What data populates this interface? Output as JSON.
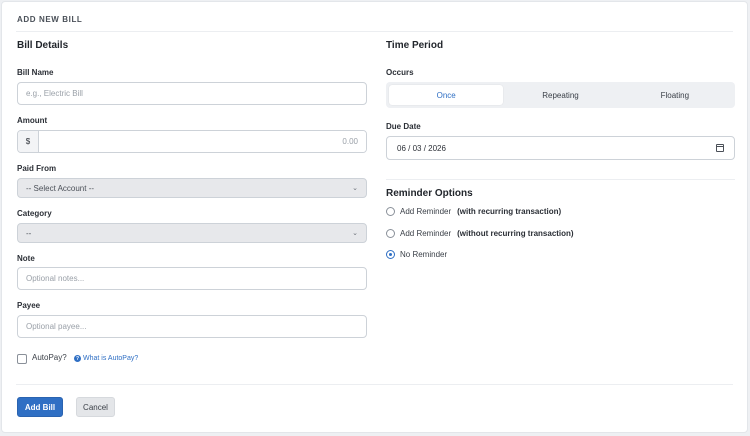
{
  "header": {
    "title": "ADD NEW BILL"
  },
  "bill_details": {
    "title": "Bill Details",
    "bill_name": {
      "label": "Bill Name",
      "placeholder": "e.g., Electric Bill",
      "value": ""
    },
    "amount": {
      "label": "Amount",
      "prefix": "$",
      "placeholder": "0.00",
      "value": ""
    },
    "paid_from": {
      "label": "Paid From",
      "selected": "-- Select Account --"
    },
    "category": {
      "label": "Category",
      "selected": "--"
    },
    "note": {
      "label": "Note",
      "placeholder": "Optional notes...",
      "value": ""
    },
    "payee": {
      "label": "Payee",
      "placeholder": "Optional payee...",
      "value": ""
    },
    "autopay": {
      "label": "AutoPay?",
      "checked": false,
      "help_label": "What is AutoPay?"
    }
  },
  "time_period": {
    "title": "Time Period",
    "occurs_label": "Occurs",
    "options": [
      {
        "label": "Once",
        "active": true
      },
      {
        "label": "Repeating",
        "active": false
      },
      {
        "label": "Floating",
        "active": false
      }
    ],
    "due_date": {
      "label": "Due Date",
      "value": "06 / 03 / 2026"
    }
  },
  "reminder": {
    "title": "Reminder Options",
    "options": [
      {
        "label": "Add Reminder",
        "suffix": "(with recurring transaction)",
        "checked": false
      },
      {
        "label": "Add Reminder",
        "suffix": "(without recurring transaction)",
        "checked": false
      },
      {
        "label": "No Reminder",
        "suffix": "",
        "checked": true
      }
    ]
  },
  "actions": {
    "add_label": "Add Bill",
    "cancel_label": "Cancel"
  },
  "colors": {
    "accent": "#2f6fc4",
    "card_bg": "#ffffff",
    "page_bg": "#eef0f3"
  },
  "icons": [
    "chevron-down-icon",
    "calendar-icon",
    "help-icon"
  ]
}
